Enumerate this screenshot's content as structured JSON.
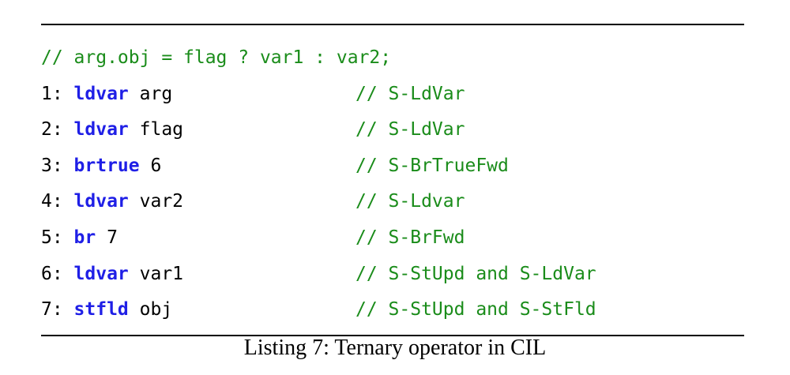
{
  "listing": {
    "header_comment": "// arg.obj = flag ? var1 : var2;",
    "lines": [
      {
        "num": "1: ",
        "keyword": "ldvar",
        "arg": " arg",
        "comment": "// S-LdVar"
      },
      {
        "num": "2: ",
        "keyword": "ldvar",
        "arg": " flag",
        "comment": "// S-LdVar"
      },
      {
        "num": "3: ",
        "keyword": "brtrue",
        "arg": " 6",
        "comment": "// S-BrTrueFwd"
      },
      {
        "num": "4: ",
        "keyword": "ldvar",
        "arg": " var2",
        "comment": "// S-Ldvar"
      },
      {
        "num": "5: ",
        "keyword": "br",
        "arg": " 7",
        "comment": "// S-BrFwd"
      },
      {
        "num": "6: ",
        "keyword": "ldvar",
        "arg": " var1",
        "comment": "// S-StUpd and S-LdVar"
      },
      {
        "num": "7: ",
        "keyword": "stfld",
        "arg": " obj",
        "comment": "// S-StUpd and S-StFld"
      }
    ],
    "caption": "Listing 7: Ternary operator in CIL"
  },
  "colors": {
    "keyword": "#1f1fe6",
    "comment": "#1a8c1a",
    "text": "#000000"
  }
}
